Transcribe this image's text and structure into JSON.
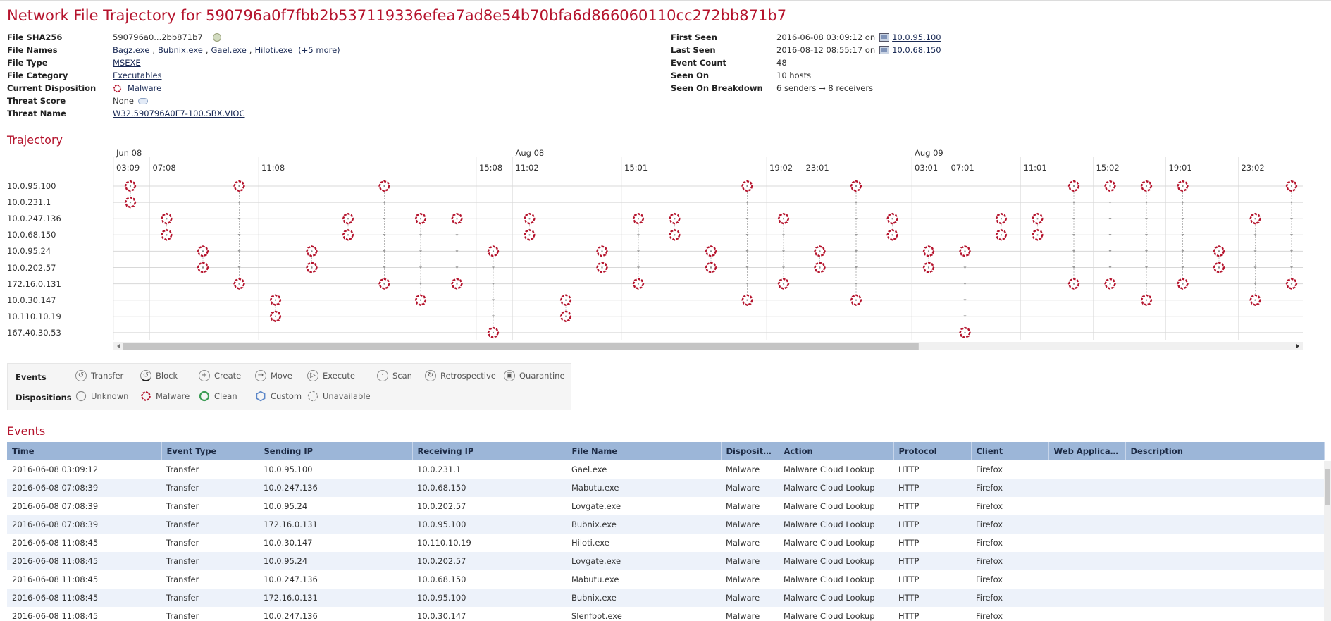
{
  "title": "Network File Trajectory for 590796a0f7fbb2b537119336efea7ad8e54b70bfa6d866060110cc272bb871b7",
  "info_left": [
    {
      "label": "File SHA256",
      "value": "590796a0...2bb871b7",
      "icon": "download-icon"
    },
    {
      "label": "File Names",
      "links": [
        "Bagz.exe",
        "Bubnix.exe",
        "Gael.exe",
        "Hiloti.exe"
      ],
      "more": "(+5 more)"
    },
    {
      "label": "File Type",
      "link": "MSEXE"
    },
    {
      "label": "File Category",
      "link": "Executables"
    },
    {
      "label": "Current Disposition",
      "link": "Malware",
      "icon": "malware-icon"
    },
    {
      "label": "Threat Score",
      "value": "None",
      "icon": "cloud-icon"
    },
    {
      "label": "Threat Name",
      "link": "W32.590796A0F7-100.SBX.VIOC"
    }
  ],
  "info_right": {
    "first_seen": {
      "label": "First Seen",
      "value": "2016-06-08 03:09:12 on",
      "host": "10.0.95.100"
    },
    "last_seen": {
      "label": "Last Seen",
      "value": "2016-08-12 08:55:17 on",
      "host": "10.0.68.150"
    },
    "event_count": {
      "label": "Event Count",
      "value": "48"
    },
    "seen_on": {
      "label": "Seen On",
      "value": "10 hosts"
    },
    "seen_on_breakdown": {
      "label": "Seen On Breakdown",
      "value": "6 senders → 8 receivers"
    }
  },
  "trajectory": {
    "heading": "Trajectory",
    "dates": [
      "Jun 08",
      "Aug 08",
      "Aug 09"
    ],
    "date_columns": [
      0,
      11,
      22
    ],
    "times": [
      {
        "col": 0,
        "label": "03:09"
      },
      {
        "col": 1,
        "label": "07:08"
      },
      {
        "col": 4,
        "label": "11:08"
      },
      {
        "col": 10,
        "label": "15:08"
      },
      {
        "col": 11,
        "label": "11:02"
      },
      {
        "col": 14,
        "label": "15:01"
      },
      {
        "col": 18,
        "label": "19:02"
      },
      {
        "col": 19,
        "label": "23:01"
      },
      {
        "col": 22,
        "label": "03:01"
      },
      {
        "col": 23,
        "label": "07:01"
      },
      {
        "col": 25,
        "label": "11:01"
      },
      {
        "col": 27,
        "label": "15:02"
      },
      {
        "col": 29,
        "label": "19:01"
      },
      {
        "col": 31,
        "label": "23:02"
      }
    ],
    "hosts": [
      "10.0.95.100",
      "10.0.231.1",
      "10.0.247.136",
      "10.0.68.150",
      "10.0.95.24",
      "10.0.202.57",
      "172.16.0.131",
      "10.0.30.147",
      "10.110.10.19",
      "167.40.30.53"
    ],
    "events": [
      {
        "col": 0,
        "rows": [
          0,
          1
        ]
      },
      {
        "col": 1,
        "rows": [
          2,
          3
        ]
      },
      {
        "col": 2,
        "rows": [
          4,
          5
        ]
      },
      {
        "col": 3,
        "rows": [
          0,
          6
        ]
      },
      {
        "col": 4,
        "rows": [
          7,
          8
        ]
      },
      {
        "col": 5,
        "rows": [
          4,
          5
        ]
      },
      {
        "col": 6,
        "rows": [
          2,
          3
        ]
      },
      {
        "col": 7,
        "rows": [
          0,
          6
        ]
      },
      {
        "col": 8,
        "rows": [
          2,
          7
        ]
      },
      {
        "col": 9,
        "rows": [
          2,
          6
        ]
      },
      {
        "col": 10,
        "rows": [
          4,
          9
        ]
      },
      {
        "col": 11,
        "rows": [
          2,
          3
        ]
      },
      {
        "col": 12,
        "rows": [
          7,
          8
        ]
      },
      {
        "col": 13,
        "rows": [
          4,
          5
        ]
      },
      {
        "col": 14,
        "rows": [
          2,
          6
        ]
      },
      {
        "col": 15,
        "rows": [
          2,
          3
        ]
      },
      {
        "col": 16,
        "rows": [
          4,
          5
        ]
      },
      {
        "col": 17,
        "rows": [
          0,
          7
        ]
      },
      {
        "col": 18,
        "rows": [
          2,
          6
        ]
      },
      {
        "col": 19,
        "rows": [
          4,
          5
        ]
      },
      {
        "col": 20,
        "rows": [
          0,
          7
        ]
      },
      {
        "col": 21,
        "rows": [
          2,
          3
        ]
      },
      {
        "col": 22,
        "rows": [
          4,
          5
        ]
      },
      {
        "col": 23,
        "rows": [
          4,
          9
        ]
      },
      {
        "col": 24,
        "rows": [
          2,
          3
        ]
      },
      {
        "col": 25,
        "rows": [
          2,
          3
        ]
      },
      {
        "col": 26,
        "rows": [
          0,
          6
        ]
      },
      {
        "col": 27,
        "rows": [
          0,
          6
        ]
      },
      {
        "col": 28,
        "rows": [
          0,
          7
        ]
      },
      {
        "col": 29,
        "rows": [
          0,
          6
        ]
      },
      {
        "col": 30,
        "rows": [
          4,
          5
        ]
      },
      {
        "col": 31,
        "rows": [
          2,
          7
        ]
      },
      {
        "col": 32,
        "rows": [
          0,
          6
        ]
      }
    ],
    "scroll_thumb_fraction": 0.68
  },
  "legend": {
    "events_label": "Events",
    "events": [
      {
        "label": "Transfer",
        "icon": "transfer-icon",
        "glyph": "↺"
      },
      {
        "label": "Block",
        "icon": "block-icon",
        "glyph": "↺"
      },
      {
        "label": "Create",
        "icon": "create-icon",
        "glyph": "+"
      },
      {
        "label": "Move",
        "icon": "move-icon",
        "glyph": "→"
      },
      {
        "label": "Execute",
        "icon": "execute-icon",
        "glyph": "▷"
      },
      {
        "label": "Scan",
        "icon": "scan-icon",
        "glyph": "·"
      },
      {
        "label": "Retrospective",
        "icon": "retrospective-icon",
        "glyph": "↻"
      },
      {
        "label": "Quarantine",
        "icon": "quarantine-icon",
        "glyph": "▣"
      }
    ],
    "dispositions_label": "Dispositions",
    "dispositions": [
      {
        "label": "Unknown",
        "icon": "unknown-icon"
      },
      {
        "label": "Malware",
        "icon": "malware-icon"
      },
      {
        "label": "Clean",
        "icon": "clean-icon"
      },
      {
        "label": "Custom",
        "icon": "custom-icon"
      },
      {
        "label": "Unavailable",
        "icon": "unavailable-icon"
      }
    ]
  },
  "events_table": {
    "heading": "Events",
    "columns": [
      "Time",
      "Event Type",
      "Sending IP",
      "Receiving IP",
      "File Name",
      "Dispositi...",
      "Action",
      "Protocol",
      "Client",
      "Web Applicat...",
      "Description"
    ],
    "rows": [
      [
        "2016-06-08 03:09:12",
        "Transfer",
        "10.0.95.100",
        "10.0.231.1",
        "Gael.exe",
        "Malware",
        "Malware Cloud Lookup",
        "HTTP",
        "Firefox",
        "",
        ""
      ],
      [
        "2016-06-08 07:08:39",
        "Transfer",
        "10.0.247.136",
        "10.0.68.150",
        "Mabutu.exe",
        "Malware",
        "Malware Cloud Lookup",
        "HTTP",
        "Firefox",
        "",
        ""
      ],
      [
        "2016-06-08 07:08:39",
        "Transfer",
        "10.0.95.24",
        "10.0.202.57",
        "Lovgate.exe",
        "Malware",
        "Malware Cloud Lookup",
        "HTTP",
        "Firefox",
        "",
        ""
      ],
      [
        "2016-06-08 07:08:39",
        "Transfer",
        "172.16.0.131",
        "10.0.95.100",
        "Bubnix.exe",
        "Malware",
        "Malware Cloud Lookup",
        "HTTP",
        "Firefox",
        "",
        ""
      ],
      [
        "2016-06-08 11:08:45",
        "Transfer",
        "10.0.30.147",
        "10.110.10.19",
        "Hiloti.exe",
        "Malware",
        "Malware Cloud Lookup",
        "HTTP",
        "Firefox",
        "",
        ""
      ],
      [
        "2016-06-08 11:08:45",
        "Transfer",
        "10.0.95.24",
        "10.0.202.57",
        "Lovgate.exe",
        "Malware",
        "Malware Cloud Lookup",
        "HTTP",
        "Firefox",
        "",
        ""
      ],
      [
        "2016-06-08 11:08:45",
        "Transfer",
        "10.0.247.136",
        "10.0.68.150",
        "Mabutu.exe",
        "Malware",
        "Malware Cloud Lookup",
        "HTTP",
        "Firefox",
        "",
        ""
      ],
      [
        "2016-06-08 11:08:45",
        "Transfer",
        "172.16.0.131",
        "10.0.95.100",
        "Bubnix.exe",
        "Malware",
        "Malware Cloud Lookup",
        "HTTP",
        "Firefox",
        "",
        ""
      ],
      [
        "2016-06-08 11:08:45",
        "Transfer",
        "10.0.247.136",
        "10.0.30.147",
        "Slenfbot.exe",
        "Malware",
        "Malware Cloud Lookup",
        "HTTP",
        "Firefox",
        "",
        ""
      ]
    ]
  },
  "colors": {
    "accent": "#b5142d",
    "header": "#9cb6d8",
    "malware": "#b5142d"
  }
}
